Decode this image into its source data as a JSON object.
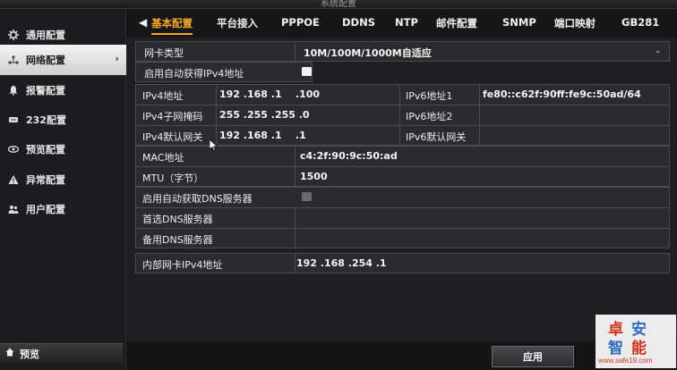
{
  "window": {
    "title": "系统配置"
  },
  "sidebar": {
    "items": [
      {
        "label": "通用配置",
        "icon": "gear-icon"
      },
      {
        "label": "网络配置",
        "icon": "network-icon",
        "active": true
      },
      {
        "label": "报警配置",
        "icon": "alarm-icon"
      },
      {
        "label": "232配置",
        "icon": "serial-port-icon"
      },
      {
        "label": "预览配置",
        "icon": "eye-icon"
      },
      {
        "label": "异常配置",
        "icon": "warning-icon"
      },
      {
        "label": "用户配置",
        "icon": "users-icon"
      }
    ],
    "preview_label": "预览"
  },
  "tabs": [
    {
      "label": "基本配置",
      "active": true
    },
    {
      "label": "平台接入"
    },
    {
      "label": "PPPOE"
    },
    {
      "label": "DDNS"
    },
    {
      "label": "NTP"
    },
    {
      "label": "邮件配置"
    },
    {
      "label": "SNMP"
    },
    {
      "label": "端口映射"
    },
    {
      "label": "GB281"
    }
  ],
  "form": {
    "nic_type": {
      "label": "网卡类型",
      "value": "10M/100M/1000M自适应"
    },
    "dhcp_ipv4": {
      "label": "启用自动获得IPv4地址",
      "checked": true
    },
    "ipv4_address": {
      "label": "IPv4地址",
      "value": "192 .168 .1    .100"
    },
    "ipv4_mask": {
      "label": "IPv4子网掩码",
      "value": "255 .255 .255 .0"
    },
    "ipv4_gateway": {
      "label": "IPv4默认网关",
      "value": "192 .168 .1    .1"
    },
    "ipv6_address1": {
      "label": "IPv6地址1",
      "value": "fe80::c62f:90ff:fe9c:50ad/64"
    },
    "ipv6_address2": {
      "label": "IPv6地址2",
      "value": ""
    },
    "ipv6_gateway": {
      "label": "IPv6默认网关",
      "value": ""
    },
    "mac": {
      "label": "MAC地址",
      "value": "c4:2f:90:9c:50:ad"
    },
    "mtu": {
      "label": "MTU（字节）",
      "value": "1500"
    },
    "dhcp_dns": {
      "label": "启用自动获取DNS服务器",
      "checked": false
    },
    "dns_primary": {
      "label": "首选DNS服务器",
      "value": ""
    },
    "dns_secondary": {
      "label": "备用DNS服务器",
      "value": ""
    },
    "internal_nic": {
      "label": "内部网卡IPv4地址",
      "value": "192 .168 .254 .1"
    }
  },
  "buttons": {
    "apply": "应用"
  },
  "watermark": {
    "chars": [
      "卓",
      "安",
      "智",
      "能"
    ],
    "url": "www.safe19.com"
  },
  "colors": {
    "accent": "#f5a623",
    "watermark_red": "#d0341e",
    "watermark_blue": "#2b6cc4"
  }
}
